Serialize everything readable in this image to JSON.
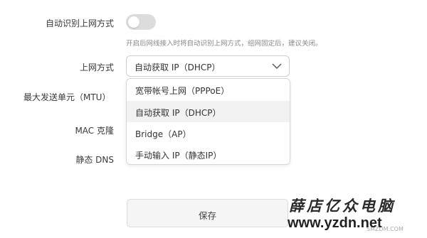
{
  "form": {
    "auto_detect": {
      "label": "自动识别上网方式",
      "enabled": false,
      "hint": "开启后网线接入时将自动识别上网方式，组网固定后，建议关闭。"
    },
    "connection_type": {
      "label": "上网方式",
      "selected": "自动获取 IP（DHCP）",
      "options": [
        "宽带帐号上网（PPPoE）",
        "自动获取 IP（DHCP）",
        "Bridge（AP）",
        "手动输入 IP（静态IP）"
      ]
    },
    "mtu_label": "最大发送单元（MTU）",
    "mac_clone_label": "MAC 克隆",
    "static_dns_label": "静态 DNS",
    "save_label": "保存"
  },
  "watermark": {
    "chinese": "薛店亿众电脑",
    "url": "www.yzdn.net",
    "smzdm": "SMZDM.COM"
  },
  "colors": {
    "toggle_off": "#dcdcdc",
    "selected_option_bg": "#f2f2f2",
    "border": "#cfcfcf"
  }
}
